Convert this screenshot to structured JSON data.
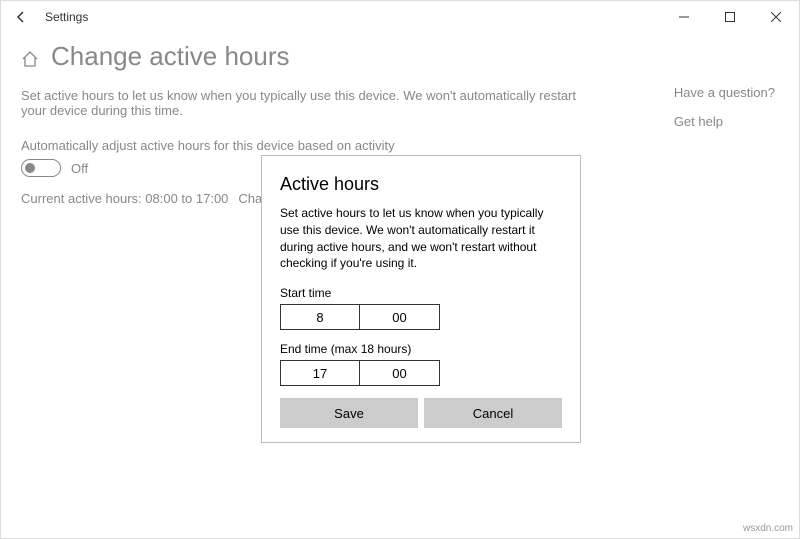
{
  "titlebar": {
    "app_name": "Settings"
  },
  "header": {
    "title": "Change active hours"
  },
  "main": {
    "description": "Set active hours to let us know when you typically use this device. We won't automatically restart your device during this time.",
    "auto_adjust_label": "Automatically adjust active hours for this device based on activity",
    "toggle_state": "Off",
    "current_hours_label": "Current active hours: 08:00 to 17:00",
    "change_link": "Change"
  },
  "help": {
    "question": "Have a question?",
    "get_help": "Get help"
  },
  "dialog": {
    "title": "Active hours",
    "description": "Set active hours to let us know when you typically use this device. We won't automatically restart it during active hours, and we won't restart without checking if you're using it.",
    "start_label": "Start time",
    "start_hour": "8",
    "start_min": "00",
    "end_label": "End time (max 18 hours)",
    "end_hour": "17",
    "end_min": "00",
    "save": "Save",
    "cancel": "Cancel"
  },
  "watermark": "wsxdn.com"
}
